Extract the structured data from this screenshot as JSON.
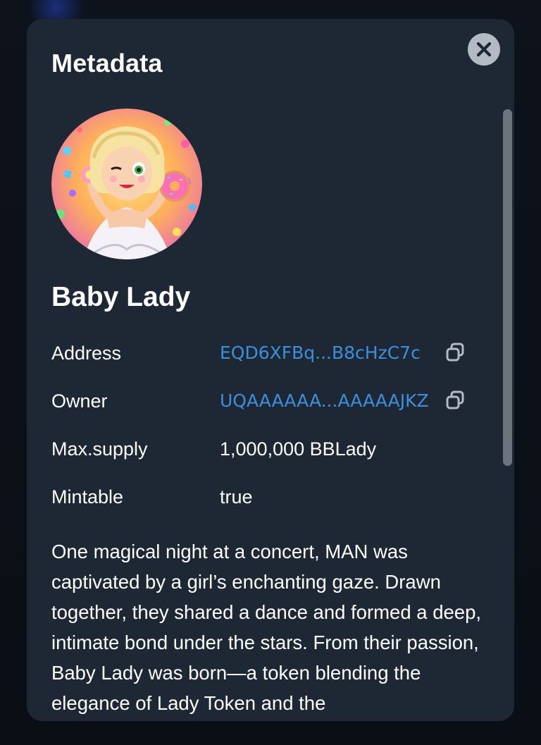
{
  "modal": {
    "title": "Metadata"
  },
  "token": {
    "name": "Baby Lady",
    "avatar_alt": "Cartoon blonde lady with donut"
  },
  "fields": {
    "address": {
      "label": "Address",
      "value": "EQD6XFBq...B8cHzC7c"
    },
    "owner": {
      "label": "Owner",
      "value": "UQAAAAAA...AAAAAJKZ"
    },
    "max_supply": {
      "label": "Max.supply",
      "value": "1,000,000 BBLady"
    },
    "mintable": {
      "label": "Mintable",
      "value": "true"
    }
  },
  "description": "One magical night at a concert, MAN was captivated by a girl’s enchanting gaze. Drawn together, they shared a dance and formed a deep, intimate bond under the stars. From their passion, Baby Lady was born—a token blending the elegance of Lady Token and the",
  "icons": {
    "close": "close-icon",
    "copy": "copy-icon"
  },
  "colors": {
    "modal_bg": "#1e2835",
    "link": "#3d8fdc",
    "text": "#ffffff",
    "close_bg": "#b3bac4"
  }
}
